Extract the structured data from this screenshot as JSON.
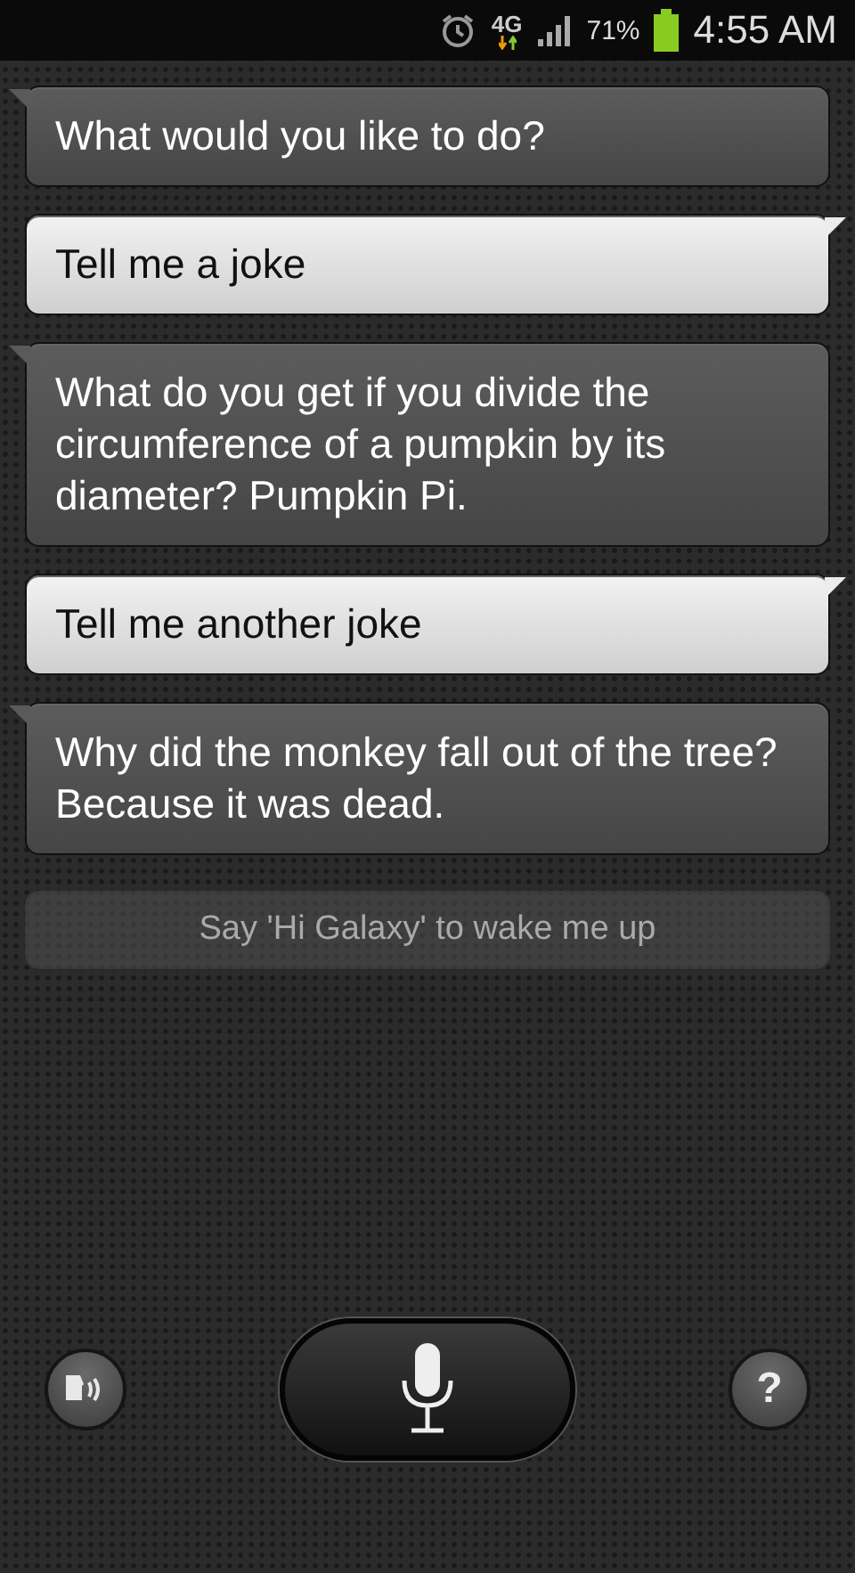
{
  "status_bar": {
    "network": "4G",
    "battery": "71%",
    "time": "4:55 AM"
  },
  "messages": [
    {
      "kind": "assistant",
      "text": "What would you like to do?"
    },
    {
      "kind": "user",
      "text": "Tell me a joke"
    },
    {
      "kind": "assistant",
      "text": "What do you get if you divide the circumference of a pumpkin by its diameter? Pumpkin Pi."
    },
    {
      "kind": "user",
      "text": "Tell me another joke"
    },
    {
      "kind": "assistant",
      "text": "Why did the monkey fall out of the tree? Because it was dead."
    }
  ],
  "hint": "Say 'Hi Galaxy' to wake me up",
  "controls": {
    "help_label": "?"
  }
}
